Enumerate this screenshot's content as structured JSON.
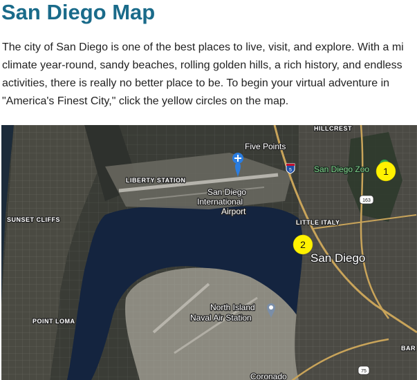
{
  "page": {
    "title": "San Diego Map",
    "intro_lines": [
      "The city of San Diego is one of the best places to live, visit, and explore. With a mi",
      "climate year-round, sandy beaches, rolling golden hills, a rich history, and endless",
      "activities, there is really no better place to be. To begin your virtual adventure in",
      "\"America's Finest City,\" click the yellow circles on the map."
    ]
  },
  "map": {
    "labels": {
      "hillcrest": "HILLCREST",
      "five_points": "Five Points",
      "san_diego_zoo": "San Diego Zoo",
      "liberty_station": "LIBERTY STATION",
      "airport_line1": "San Diego",
      "airport_line2": "International",
      "airport_line3": "Airport",
      "sunset_cliffs": "SUNSET CLIFFS",
      "little_italy": "LITTLE ITALY",
      "san_diego": "San Diego",
      "north_island_line1": "North Island",
      "north_island_line2": "Naval Air Station",
      "point_loma": "POINT LOMA",
      "barrio": "BAR",
      "coronado": "Coronado"
    },
    "shields": {
      "i5": "5",
      "sr163": "163",
      "sr75": "75"
    },
    "markers": [
      {
        "number": "1",
        "color": "#fff200"
      },
      {
        "number": "2",
        "color": "#fff200"
      }
    ]
  }
}
